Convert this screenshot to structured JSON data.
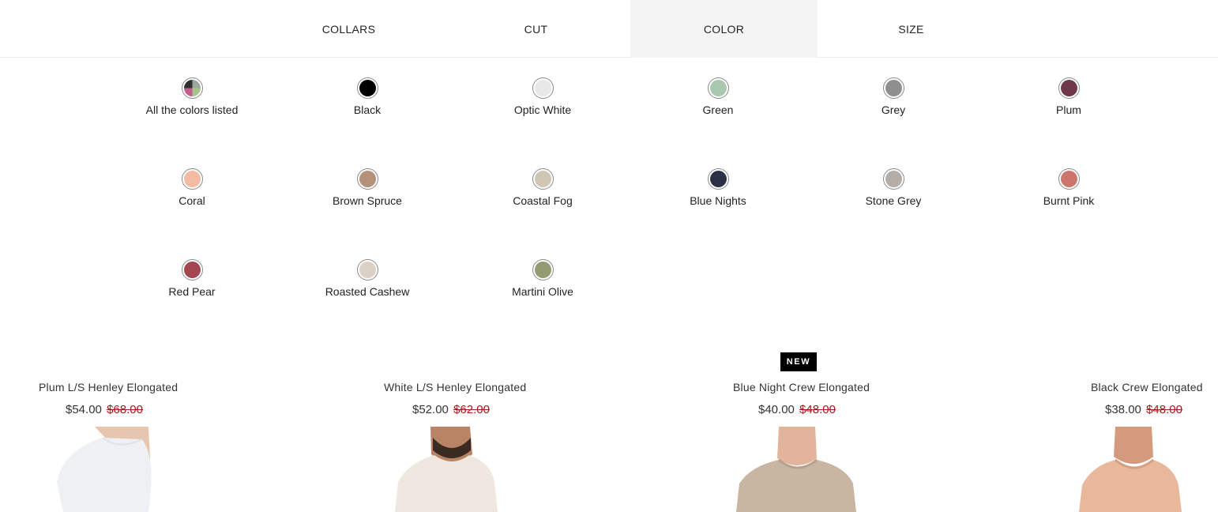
{
  "tabs": [
    {
      "label": "COLLARS",
      "active": false
    },
    {
      "label": "CUT",
      "active": false
    },
    {
      "label": "COLOR",
      "active": true
    },
    {
      "label": "SIZE",
      "active": false
    }
  ],
  "colors": [
    {
      "label": "All the colors listed",
      "hex": "multi"
    },
    {
      "label": "Black",
      "hex": "#000000"
    },
    {
      "label": "Optic White",
      "hex": "#e8e8e8"
    },
    {
      "label": "Green",
      "hex": "#a9c9ae"
    },
    {
      "label": "Grey",
      "hex": "#8f8f8f"
    },
    {
      "label": "Plum",
      "hex": "#6e3947"
    },
    {
      "label": "Coral",
      "hex": "#f2bba2"
    },
    {
      "label": "Brown Spruce",
      "hex": "#b5917a"
    },
    {
      "label": "Coastal Fog",
      "hex": "#cfc6b3"
    },
    {
      "label": "Blue Nights",
      "hex": "#2d3145"
    },
    {
      "label": "Stone Grey",
      "hex": "#b3aca7"
    },
    {
      "label": "Burnt Pink",
      "hex": "#cd746d"
    },
    {
      "label": "Red Pear",
      "hex": "#a44650"
    },
    {
      "label": "Roasted Cashew",
      "hex": "#dcd1c6"
    },
    {
      "label": "Martini Olive",
      "hex": "#939b73"
    }
  ],
  "products": [
    {
      "name": "Plum L/S Henley Elongated",
      "price": "$54.00",
      "old_price": "$68.00",
      "shirt_color": "#eef0f3"
    },
    {
      "name": "White L/S Henley Elongated",
      "price": "$52.00",
      "old_price": "$62.00",
      "shirt_color": "#efe8e0"
    },
    {
      "name": "Blue Night Crew Elongated",
      "price": "$40.00",
      "old_price": "$48.00",
      "shirt_color": "#c8b6a3",
      "badge": "NEW"
    },
    {
      "name": "Black Crew Elongated",
      "price": "$38.00",
      "old_price": "$48.00",
      "shirt_color": "#e9b79a"
    }
  ],
  "theme": {
    "accent": "#000000",
    "sale_red": "#a51a1a",
    "active_tab_bg": "#f4f4f4"
  }
}
